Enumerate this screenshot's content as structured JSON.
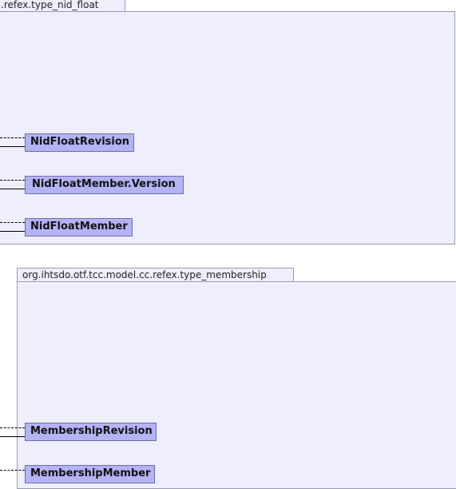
{
  "packages": [
    {
      "label": ".refex.type_nid_float",
      "classes": [
        "NidFloatRevision",
        "NidFloatMember.Version",
        "NidFloatMember"
      ]
    },
    {
      "label": "org.ihtsdo.otf.tcc.model.cc.refex.type_membership",
      "classes": [
        "MembershipRevision",
        "MembershipMember"
      ]
    }
  ],
  "colors": {
    "package_fill": "#eeeefc",
    "package_border": "#9a9ab0",
    "class_fill": "#b3b3f5",
    "class_border": "#6e6ea8"
  }
}
